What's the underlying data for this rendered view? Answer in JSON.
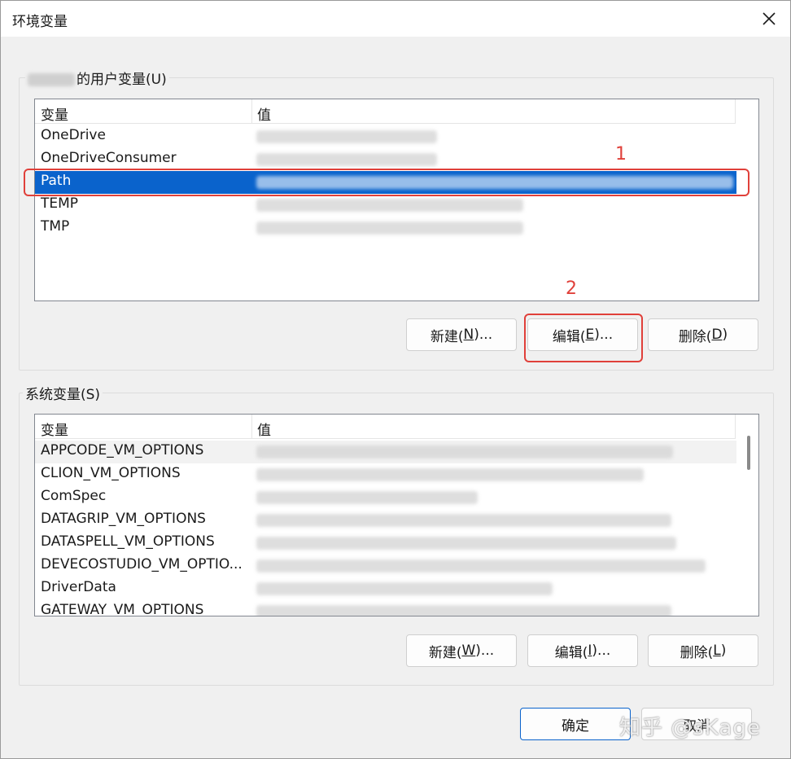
{
  "window": {
    "title": "环境变量",
    "close_icon": "close-icon"
  },
  "user_vars": {
    "group_label": "的用户变量(U)",
    "header": {
      "name": "变量",
      "value": "值"
    },
    "rows": [
      {
        "name": "OneDrive"
      },
      {
        "name": "OneDriveConsumer"
      },
      {
        "name": "Path"
      },
      {
        "name": "TEMP"
      },
      {
        "name": "TMP"
      }
    ],
    "buttons": {
      "new": "新建(",
      "new_key": "N",
      "new_tail": ")...",
      "edit": "编辑(",
      "edit_key": "E",
      "edit_tail": ")...",
      "delete": "删除(",
      "delete_key": "D",
      "delete_tail": ")"
    }
  },
  "system_vars": {
    "group_label": "系统变量(S)",
    "header": {
      "name": "变量",
      "value": "值"
    },
    "rows": [
      {
        "name": "APPCODE_VM_OPTIONS"
      },
      {
        "name": "CLION_VM_OPTIONS"
      },
      {
        "name": "ComSpec"
      },
      {
        "name": "DATAGRIP_VM_OPTIONS"
      },
      {
        "name": "DATASPELL_VM_OPTIONS"
      },
      {
        "name": "DEVECOSTUDIO_VM_OPTIO..."
      },
      {
        "name": "DriverData"
      },
      {
        "name": "GATEWAY_VM_OPTIONS"
      }
    ],
    "buttons": {
      "new": "新建(",
      "new_key": "W",
      "new_tail": ")...",
      "edit": "编辑(",
      "edit_key": "I",
      "edit_tail": ")...",
      "delete": "删除(",
      "delete_key": "L",
      "delete_tail": ")"
    }
  },
  "footer": {
    "ok": "确定",
    "cancel": "取消"
  },
  "annotations": {
    "one": "1",
    "two": "2",
    "color": "#e0403a"
  },
  "watermark": "知乎 @sKage",
  "colors": {
    "selection": "#0a63cc",
    "background": "#f0f0f0"
  }
}
